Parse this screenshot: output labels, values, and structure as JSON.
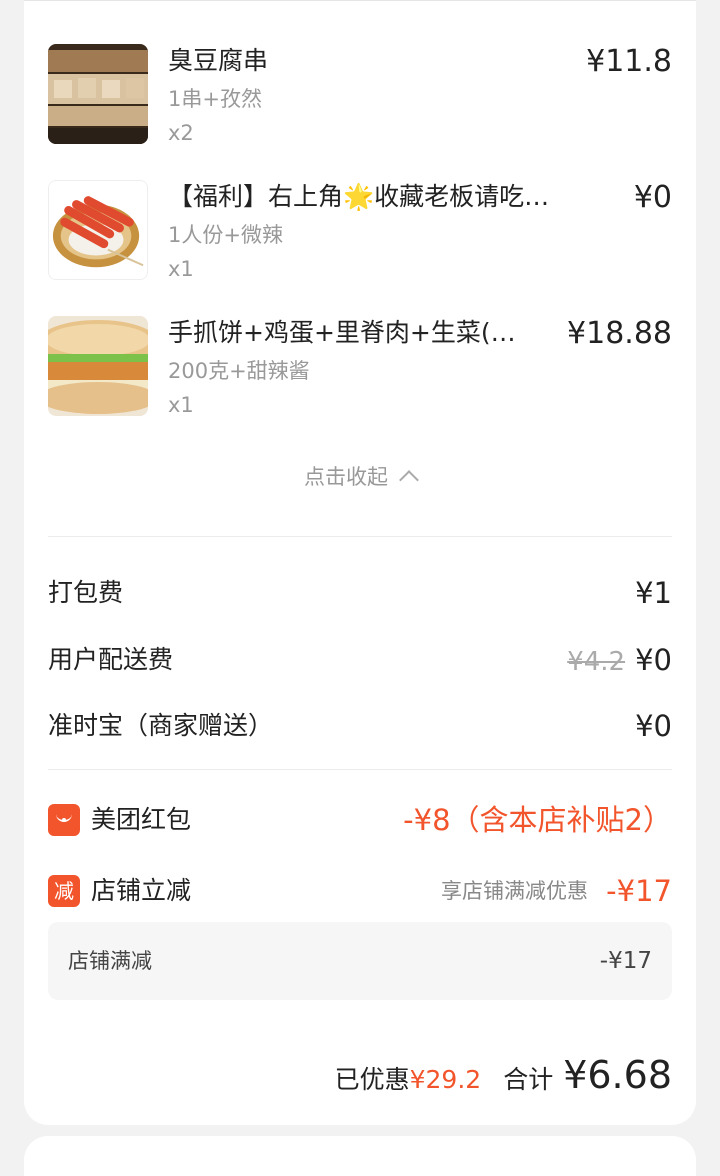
{
  "items": [
    {
      "name": "臭豆腐串",
      "spec": "1串+孜然",
      "qty": "x2",
      "price": "¥11.8",
      "image": "stinky-tofu-skewer"
    },
    {
      "name": "【福利】右上角🌟收藏老板请吃…",
      "spec": "1人份+微辣",
      "qty": "x1",
      "price": "¥0",
      "image": "sausage-skewers"
    },
    {
      "name": "手抓饼+鸡蛋+里脊肉+生菜(…",
      "spec": "200克+甜辣酱",
      "qty": "x1",
      "price": "¥18.88",
      "image": "pancake-wrap"
    }
  ],
  "collapse_label": "点击收起",
  "fees": {
    "packing": {
      "label": "打包费",
      "value": "¥1"
    },
    "delivery": {
      "label": "用户配送费",
      "original": "¥4.2",
      "value": "¥0"
    },
    "ontime": {
      "label": "准时宝（商家赠送）",
      "value": "¥0"
    }
  },
  "promos": {
    "redpacket": {
      "label": "美团红包",
      "value": "-¥8（含本店补贴2）",
      "icon": "red-envelope-icon"
    },
    "discount": {
      "label": "店铺立减",
      "badge": "减",
      "note": "享店铺满减优惠",
      "value": "-¥17"
    }
  },
  "discount_detail": {
    "label": "店铺满减",
    "value": "-¥17"
  },
  "totals": {
    "saved_label": "已优惠",
    "saved_value": "¥29.2",
    "sum_label": "合计",
    "sum_value": "¥6.68"
  },
  "colors": {
    "accent": "#f2552c",
    "muted": "#999999",
    "text": "#222222"
  }
}
